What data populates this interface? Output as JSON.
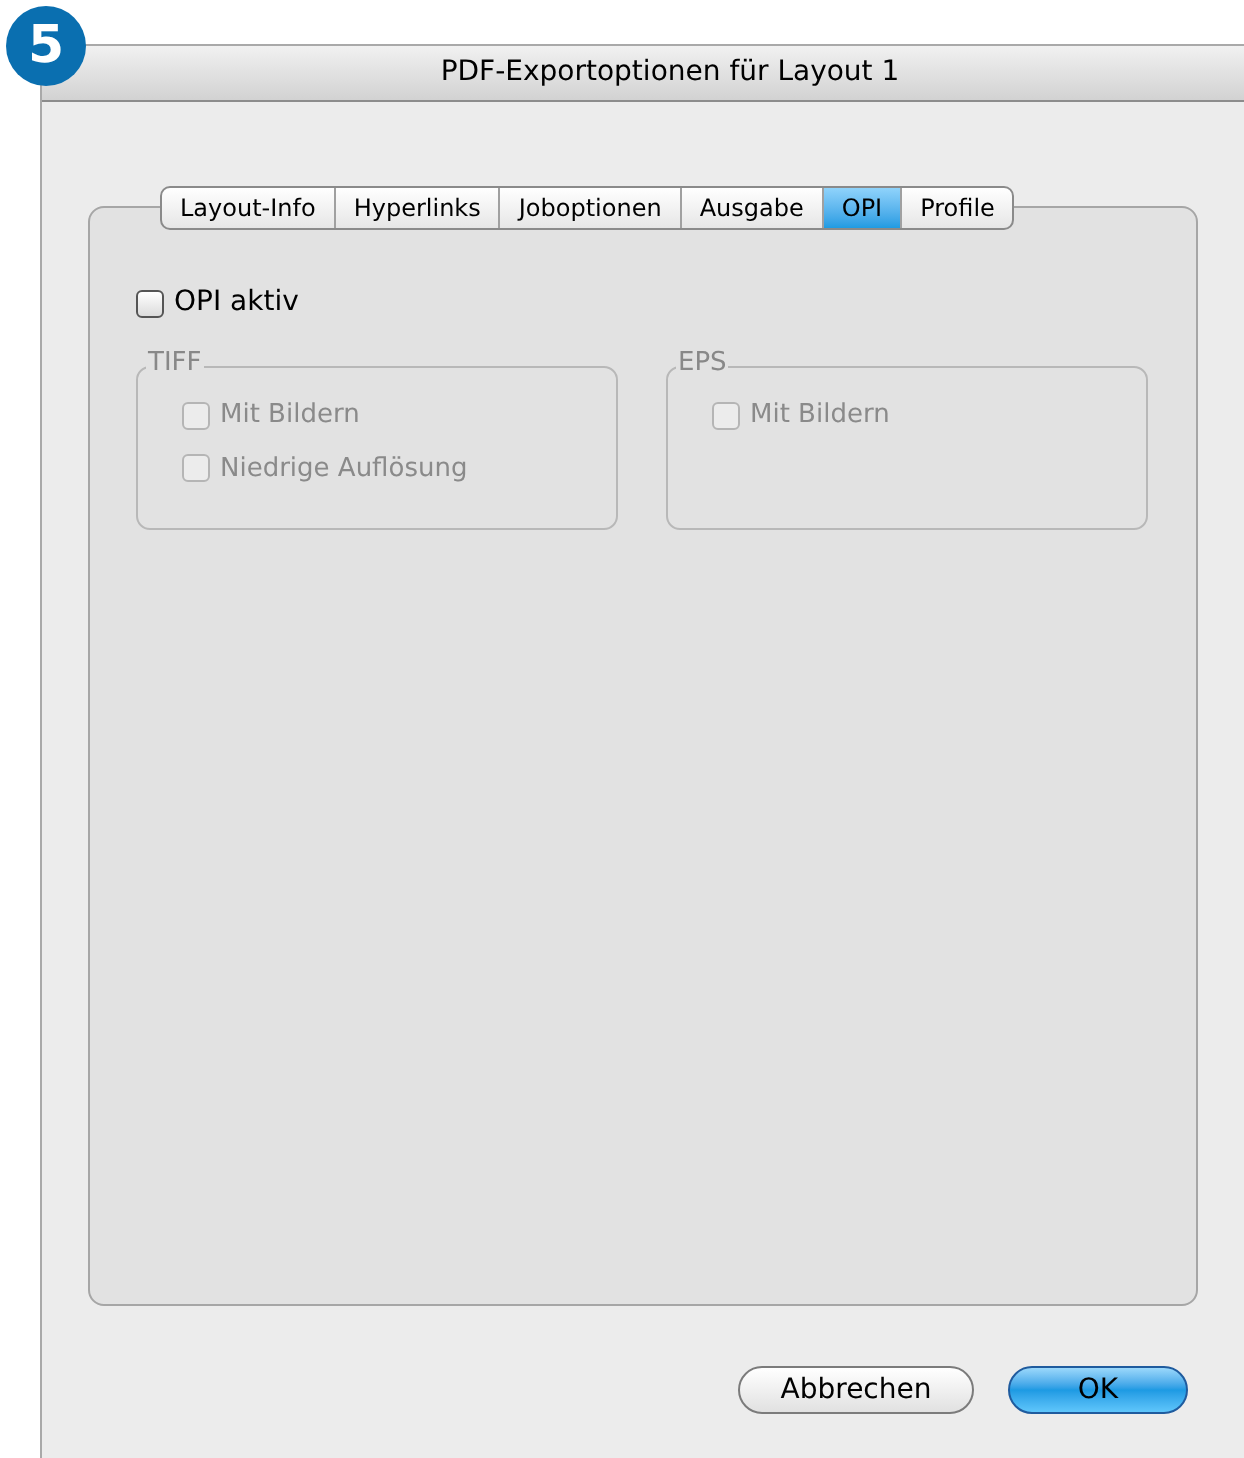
{
  "step_badge": "5",
  "window": {
    "title": "PDF-Exportoptionen für Layout 1"
  },
  "tabs": [
    {
      "label": "Layout-Info",
      "selected": false
    },
    {
      "label": "Hyperlinks",
      "selected": false
    },
    {
      "label": "Joboptionen",
      "selected": false
    },
    {
      "label": "Ausgabe",
      "selected": false
    },
    {
      "label": "OPI",
      "selected": true
    },
    {
      "label": "Profile",
      "selected": false
    }
  ],
  "opi_active": {
    "label": "OPI aktiv",
    "checked": false,
    "disabled": false
  },
  "groups": [
    {
      "title": "TIFF",
      "options": [
        {
          "label": "Mit Bildern",
          "checked": false,
          "disabled": true
        },
        {
          "label": "Niedrige Auflösung",
          "checked": false,
          "disabled": true
        }
      ]
    },
    {
      "title": "EPS",
      "options": [
        {
          "label": "Mit Bildern",
          "checked": false,
          "disabled": true
        }
      ]
    }
  ],
  "buttons": [
    {
      "label": "Abbrechen",
      "kind": "normal"
    },
    {
      "label": "OK",
      "kind": "default"
    }
  ]
}
